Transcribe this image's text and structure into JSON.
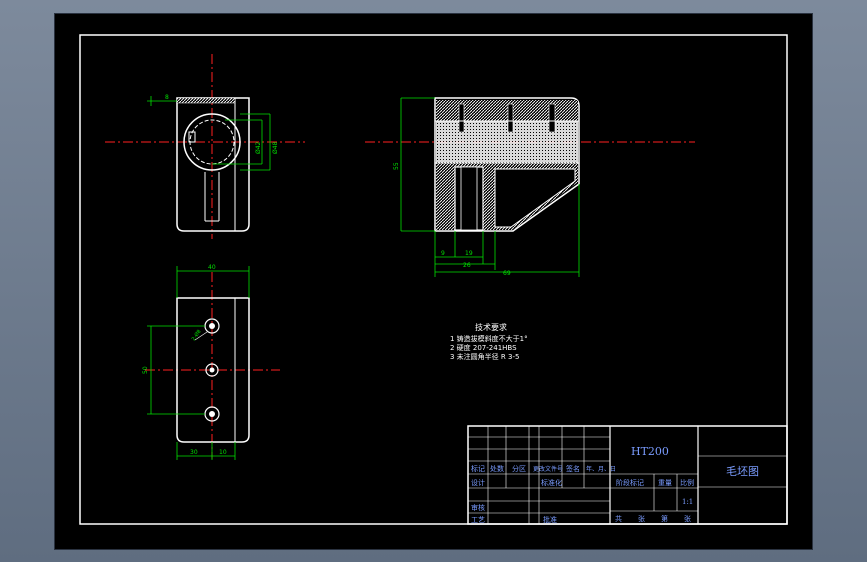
{
  "tech_notes": {
    "heading": "技术要求",
    "items": [
      "1 铸造拔模斜度不大于1°",
      "2 硬度 207-241HBS",
      "3 未注圆角半径 R 3-5"
    ]
  },
  "dimensions": {
    "top_left": {
      "small_width": "8",
      "bore_a": "Ø42",
      "bore_b": "Ø48"
    },
    "side_view": {
      "height": "55",
      "d1": "9",
      "d2": "19",
      "d3": "26",
      "overall": "69"
    },
    "bottom_view": {
      "width": "40",
      "hole_spacing": "50",
      "left_offset": "30",
      "right_offset": "10",
      "hole_label": "2-Ø8"
    }
  },
  "title_block": {
    "material": "HT200",
    "drawing_name": "毛坯图",
    "header_row": [
      "标记",
      "处数",
      "分区",
      "更改文件号",
      "签名",
      "年、月、日"
    ],
    "rows": [
      "设计",
      "审核",
      "工艺"
    ],
    "standardization": "标准化",
    "approval": "批准",
    "stage_mark": "阶段标记",
    "weight": "重量",
    "scale_label": "比例",
    "scale_value": "1:1",
    "sheet_row": [
      "共",
      "张",
      "第",
      "张"
    ]
  },
  "colors": {
    "background": "#000000",
    "outline": "#ffffff",
    "centerline": "#ff2020",
    "dimension": "#00e000",
    "title_text": "#7a9cff",
    "hatch": "#ffffff"
  }
}
